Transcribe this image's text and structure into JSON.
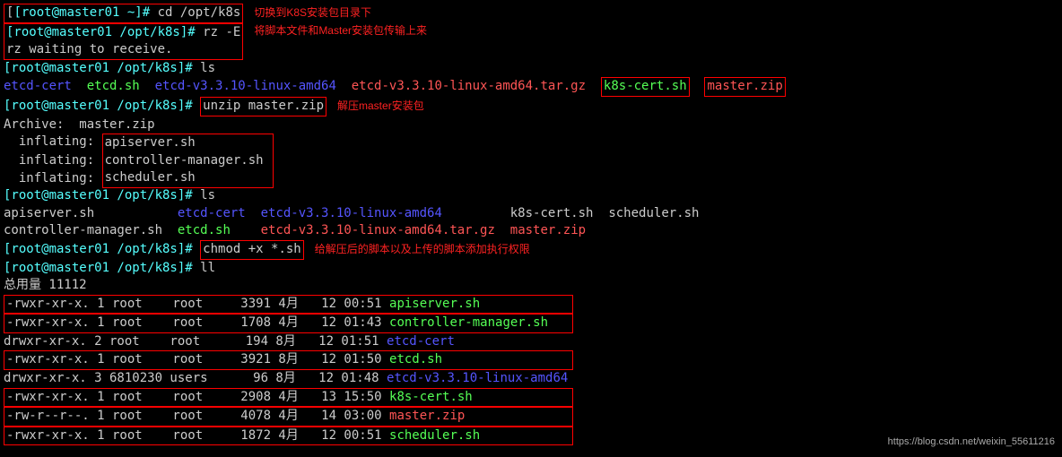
{
  "prompts": {
    "home": "[root@master01 ~]#",
    "k8s": "[root@master01 /opt/k8s]#"
  },
  "cmds": {
    "cd": "cd /opt/k8s",
    "rz": "rz -E",
    "ls1": "ls",
    "unzip": "unzip master.zip",
    "ls2": "ls",
    "chmod": "chmod +x *.sh",
    "ll": "ll"
  },
  "notes": {
    "cd": "切换到K8S安装包目录下",
    "rz": "将脚本文件和Master安装包传输上来",
    "unzip": "解压master安装包",
    "chmod": "给解压后的脚本以及上传的脚本添加执行权限"
  },
  "rz_wait": "rz waiting to receive.",
  "ls1": {
    "etcd_cert": "etcd-cert",
    "etcd_sh": "etcd.sh",
    "etcd_dir": "etcd-v3.3.10-linux-amd64",
    "etcd_tar": "etcd-v3.3.10-linux-amd64.tar.gz",
    "k8s_cert": "k8s-cert.sh",
    "master_zip": "master.zip"
  },
  "archive": {
    "header": "Archive:  master.zip",
    "inflating": "  inflating: ",
    "f1": "apiserver.sh",
    "f2": "controller-manager.sh",
    "f3": "scheduler.sh"
  },
  "ls2": {
    "r1c1": "apiserver.sh",
    "r1c2": "etcd-cert",
    "r1c3": "etcd-v3.3.10-linux-amd64",
    "r1c4": "k8s-cert.sh",
    "r1c5": "scheduler.sh",
    "r2c1": "controller-manager.sh",
    "r2c2": "etcd.sh",
    "r2c3": "etcd-v3.3.10-linux-amd64.tar.gz",
    "r2c4": "master.zip"
  },
  "ll": {
    "total": "总用量 11112",
    "rows": [
      {
        "perm": "-rwxr-xr-x.",
        "links": "1",
        "owner": "root   ",
        "group": "root ",
        "size": "   3391",
        "month": "4月 ",
        "day": " 12",
        "time": "00:51",
        "name": "apiserver.sh",
        "color": "green",
        "boxed": true
      },
      {
        "perm": "-rwxr-xr-x.",
        "links": "1",
        "owner": "root   ",
        "group": "root ",
        "size": "   1708",
        "month": "4月 ",
        "day": " 12",
        "time": "01:43",
        "name": "controller-manager.sh",
        "color": "green",
        "boxed": true
      },
      {
        "perm": "drwxr-xr-x.",
        "links": "2",
        "owner": "root   ",
        "group": "root ",
        "size": "    194",
        "month": "8月 ",
        "day": " 12",
        "time": "01:51",
        "name": "etcd-cert",
        "color": "blue",
        "boxed": false
      },
      {
        "perm": "-rwxr-xr-x.",
        "links": "1",
        "owner": "root   ",
        "group": "root ",
        "size": "   3921",
        "month": "8月 ",
        "day": " 12",
        "time": "01:50",
        "name": "etcd.sh",
        "color": "green",
        "boxed": true
      },
      {
        "perm": "drwxr-xr-x.",
        "links": "3",
        "owner": "6810230",
        "group": "users",
        "size": "     96",
        "month": "8月 ",
        "day": " 12",
        "time": "01:48",
        "name": "etcd-v3.3.10-linux-amd64",
        "color": "blue",
        "boxed": false
      },
      {
        "perm": "-rwxr-xr-x.",
        "links": "1",
        "owner": "root   ",
        "group": "root ",
        "size": "   2908",
        "month": "4月 ",
        "day": " 13",
        "time": "15:50",
        "name": "k8s-cert.sh",
        "color": "green",
        "boxed": true
      },
      {
        "perm": "-rw-r--r--.",
        "links": "1",
        "owner": "root   ",
        "group": "root ",
        "size": "   4078",
        "month": "4月 ",
        "day": " 14",
        "time": "03:00",
        "name": "master.zip",
        "color": "red",
        "boxed": true
      },
      {
        "perm": "-rwxr-xr-x.",
        "links": "1",
        "owner": "root   ",
        "group": "root ",
        "size": "   1872",
        "month": "4月 ",
        "day": " 12",
        "time": "00:51",
        "name": "scheduler.sh",
        "color": "green",
        "boxed": true
      }
    ]
  },
  "watermark": "https://blog.csdn.net/weixin_55611216"
}
